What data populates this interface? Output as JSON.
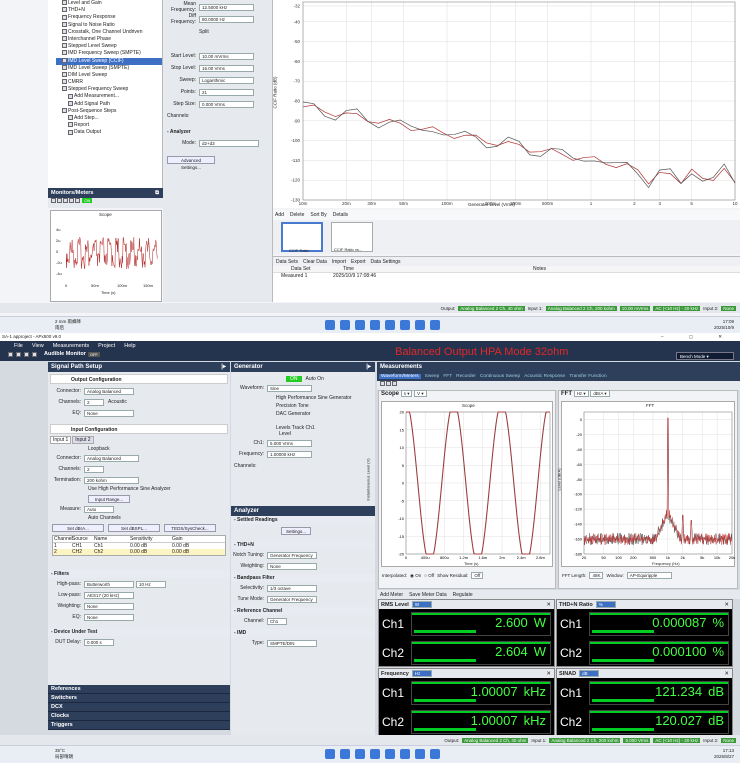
{
  "top": {
    "tree": [
      "Level and Gain",
      "THD+N",
      "Frequency Response",
      "Signal to Noise Ratio",
      "Crosstalk, One Channel Undriven",
      "Interchannel Phase",
      "Stepped Level Sweep",
      "IMD Frequency Sweep (SMPTE)",
      "IMD Level Sweep (CCIF)",
      "IMD Level Sweep (SMPTE)",
      "DIM Level Sweep",
      "CMRR",
      "Stepped Frequency Sweep",
      "Add Measurement...",
      "Add Signal Path",
      "Post-Sequence Steps",
      "Add Step...",
      "Report",
      "Data Output"
    ],
    "fields": [
      [
        "Mean Frequency:",
        "12.5000 kHz"
      ],
      [
        "Diff Frequency:",
        "80.0000 Hz"
      ],
      [
        "",
        "Split"
      ],
      [
        "Start Level:",
        "10.00 mVrms"
      ],
      [
        "Stop Level:",
        "16.00 Vrms"
      ],
      [
        "Sweep:",
        "Logarithmic"
      ],
      [
        "Points:",
        "21"
      ],
      [
        "Step Size:",
        "0.000 Vrms"
      ]
    ],
    "channels_label": "Channels:",
    "analyzer": "- Analyzer",
    "mode_label": "Mode:",
    "mode": "d2+d3",
    "adv": "Advanced Settings...",
    "edit": "Edit...",
    "monitors": "Monitors/Meters",
    "scope": "Scope",
    "on": "ON",
    "y_ticks": [
      "-32",
      "-40",
      "-50",
      "-60",
      "-70",
      "-80",
      "-90",
      "-100",
      "-110",
      "-120",
      "-130"
    ],
    "y_label": "CCIF Ratio (dB)",
    "x_ticks": [
      "10m",
      "20m",
      "30m",
      "50m",
      "100m",
      "200m",
      "300m",
      "500m",
      "1",
      "2",
      "3",
      "5",
      "10"
    ],
    "x_label": "Generator Level (Vrms)",
    "scope_y": [
      "4u",
      "2u",
      "0",
      "-2u",
      "-4u"
    ],
    "scope_x": [
      "0",
      "50m",
      "100m",
      "150m"
    ],
    "scope_xl": "Time (s)",
    "scope_yl": "Instantaneous Level (V)",
    "toolbar": [
      "Add",
      "Delete",
      "Sort By",
      "Details"
    ],
    "thumbs": [
      "CCIF Ratio",
      "CCIF Ratio vs..."
    ],
    "datasets": {
      "label": "Data Sets",
      "clear": "Clear Data",
      "import": "Import",
      "export": "Export",
      "settings": "Data Settings",
      "cols": [
        "Data Set",
        "Time",
        "Notes"
      ],
      "row": [
        "Measured 1",
        "2025/10/9 17:08:46",
        ""
      ]
    },
    "status": {
      "output": "Output:",
      "out_val": "Analog Balanced 2 Ch, 40 ohm",
      "input": "Input 1:",
      "in_val": "Analog Balanced 2 Ch, 200 kohm",
      "v1": "10.00 mVrms",
      "v2": "AC (<10 Hz) - 20 kHz",
      "input2": "Input 2:",
      "none": "None"
    },
    "weather": {
      "temp": "2 mm 雨蜂降",
      "sub": "雨后"
    },
    "clock": {
      "time": "17:09",
      "date": "2025/10/9"
    }
  },
  "bottom": {
    "window_title": "SA-1 approject - APx500 v9.0",
    "menu": [
      "File",
      "View",
      "Measurements",
      "Project",
      "Help"
    ],
    "monitor": "Audible Monitor",
    "off": "OFF",
    "title": "Balanced Output HPA Mode 32ohm",
    "bench": "Bench Mode",
    "sps": "Signal Path Setup",
    "out_conf": "Output Configuration",
    "connector_l": "Connector:",
    "connector": "Analog Balanced",
    "channels_l": "Channels:",
    "channels": "2",
    "acoustic": "Acoustic",
    "eq_l": "EQ:",
    "eq": "None",
    "in_conf": "Input Configuration",
    "in_tabs": [
      "Input 1",
      "Input 2"
    ],
    "loopback": "Loopback",
    "in_conn": "Analog Balanced",
    "in_ch": "2",
    "term_l": "Termination:",
    "term": "200 kohm",
    "hps": "Use High Performance Sine Analyzer",
    "in_range": "Input Range...",
    "measure_l": "Measure:",
    "measure": "Auto",
    "auto_ch": "Auto Channels",
    "set_dbr": "Set dBrA...",
    "set_dbspl": "Set dBSPL...",
    "teds": "TEDS/SysCheck...",
    "ch_cols": [
      "Channel",
      "Source",
      "Name",
      "Sensitivity",
      "Gain"
    ],
    "ch_rows": [
      [
        "1",
        "CH1",
        "Ch1",
        "0.00 dB",
        "0.00 dB"
      ],
      [
        "2",
        "CH2",
        "Ch2",
        "0.00 dB",
        "0.00 dB"
      ]
    ],
    "filters": "- Filters",
    "hp_l": "High-pass:",
    "hp": "Butterworth",
    "hp_f": "10 Hz",
    "lp_l": "Low-pass:",
    "lp": "AES17 (20 kHz)",
    "wt_l": "Weighting:",
    "wt": "None",
    "eq2_l": "EQ:",
    "eq2": "None",
    "dut": "- Device Under Test",
    "dut_l": "DUT Delay:",
    "dut_v": "0.000 s",
    "sidebar_bottom": [
      "References",
      "Switchers",
      "DCX",
      "Clocks",
      "Triggers"
    ],
    "gen": "Generator",
    "gen_on": "ON",
    "auto_on": "Auto On",
    "wave_l": "Waveform:",
    "wave": "Sine",
    "hps_gen": "High Performance Sine Generator",
    "precision": "Precision Tone",
    "dac": "DAC Generator",
    "levels": "Levels Track Ch1",
    "level_l": "Level",
    "ch1_l": "Ch1:",
    "ch1": "5.000 Vrms",
    "freq_l": "Frequency:",
    "freq": "1.00000 kHz",
    "channels2": "Channels:",
    "an": "Analyzer",
    "settled": "- Settled Readings",
    "settings": "Settings...",
    "thdn": "- THD+N",
    "notch_l": "Notch Tuning:",
    "notch": "Generator Frequency",
    "weight_l": "Weighting:",
    "weight": "None",
    "bpf": "- Bandpass Filter",
    "sel_l": "Selectivity:",
    "sel": "1/3 octave",
    "tune_l": "Tune Mode:",
    "tune": "Generator Frequency",
    "ref": "- Reference Channel",
    "refch_l": "Channel:",
    "refch": "Ch1",
    "imd": "- IMD",
    "type_l": "Type:",
    "type": "SMPTE/DIN",
    "meas": "Measurements",
    "meas_tabs": [
      "Waveform/Meters",
      "Sweep",
      "FFT",
      "Recorder",
      "Continuous Sweep",
      "Acoustic Response",
      "Transfer Function"
    ],
    "scope": "Scope",
    "scope_title": "Scope",
    "scope_y": [
      "20",
      "15",
      "10",
      "5",
      "0",
      "-5",
      "-10",
      "-15",
      "-20"
    ],
    "scope_x": [
      "0",
      "400u",
      "800u",
      "1.2m",
      "1.6m",
      "2m",
      "2.4m",
      "2.8m"
    ],
    "scope_xl": "Time (s)",
    "scope_yl": "Instantaneous Level (V)",
    "interp": "Interpolated:",
    "on_": "On",
    "off_": "Off",
    "show_resid": "Show Residual:",
    "resid": "Off",
    "fft": "FFT",
    "fft_title": "FFT",
    "fft_unit": "dBrA",
    "fft_y": [
      "0",
      "-20",
      "-40",
      "-60",
      "-80",
      "-100",
      "-120",
      "-140",
      "-160",
      "-180"
    ],
    "fft_x": [
      "20",
      "50",
      "100",
      "200",
      "500",
      "1k",
      "2k",
      "5k",
      "10k",
      "20k"
    ],
    "fft_xl": "Frequency (Hz)",
    "fft_yl": "Level (dBrA)",
    "fft_len_l": "FFT Length:",
    "fft_len": "48K",
    "window_l": "Window:",
    "window": "AP-Equiripple",
    "meter_tb": [
      "Add Meter",
      "Save Meter Data",
      "Regulate"
    ],
    "meters": [
      {
        "title": "RMS Level",
        "unit_sel": "W",
        "rows": [
          [
            "Ch1",
            "2.600",
            "W"
          ],
          [
            "Ch2",
            "2.604",
            "W"
          ]
        ]
      },
      {
        "title": "THD+N Ratio",
        "unit_sel": "%",
        "rows": [
          [
            "Ch1",
            "0.000087",
            "%"
          ],
          [
            "Ch2",
            "0.000100",
            "%"
          ]
        ]
      },
      {
        "title": "Frequency",
        "unit_sel": "Hz",
        "rows": [
          [
            "Ch1",
            "1.00007",
            "kHz"
          ],
          [
            "Ch2",
            "1.00007",
            "kHz"
          ]
        ]
      },
      {
        "title": "SINAD",
        "unit_sel": "dB",
        "rows": [
          [
            "Ch1",
            "121.234",
            "dB"
          ],
          [
            "Ch2",
            "120.027",
            "dB"
          ]
        ]
      }
    ],
    "status": {
      "output": "Output:",
      "out_val": "Analog Balanced 2 Ch, 40 ohm",
      "input": "Input 1:",
      "in_val": "Analog Balanced 2 Ch, 200 kohm",
      "v1": "5.000 Vrms",
      "v2": "AC (<10 Hz) - 20 kHz",
      "input2": "Input 2:",
      "none": "None"
    },
    "weather": {
      "temp": "35°C",
      "sub": "局部晴朗"
    },
    "clock": {
      "time": "17:13",
      "date": "2025/8/27"
    }
  }
}
